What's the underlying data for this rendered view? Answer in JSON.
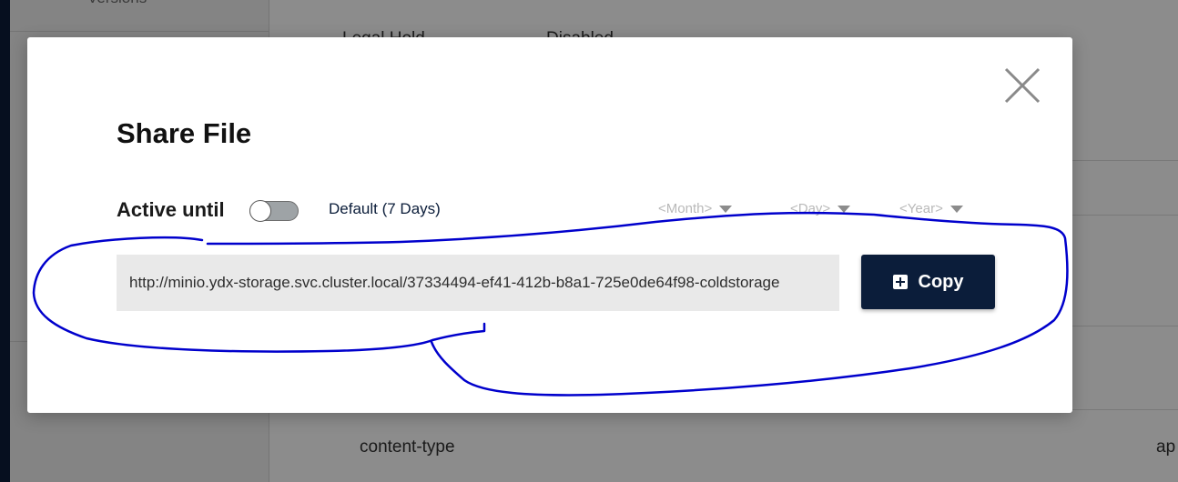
{
  "background": {
    "sidebar_versions": "Versions",
    "row1_key": "Legal Hold",
    "row1_value": "Disabled",
    "content_type_key": "content-type",
    "content_type_value": "ap"
  },
  "modal": {
    "title": "Share File",
    "active_until_label": "Active until",
    "toggle_on": false,
    "default_label": "Default (7 Days)",
    "month_placeholder": "<Month>",
    "day_placeholder": "<Day>",
    "year_placeholder": "<Year>",
    "share_url": "http://minio.ydx-storage.svc.cluster.local/37334494-ef41-412b-b8a1-725e0de64f98-coldstorage",
    "copy_label": "Copy"
  },
  "icons": {
    "close": "close-icon",
    "copy": "plus-square-icon",
    "caret": "caret-down-icon"
  },
  "colors": {
    "primary": "#0b1d3a",
    "annotation": "#0000cc",
    "url_bg": "#e9e9e9"
  }
}
